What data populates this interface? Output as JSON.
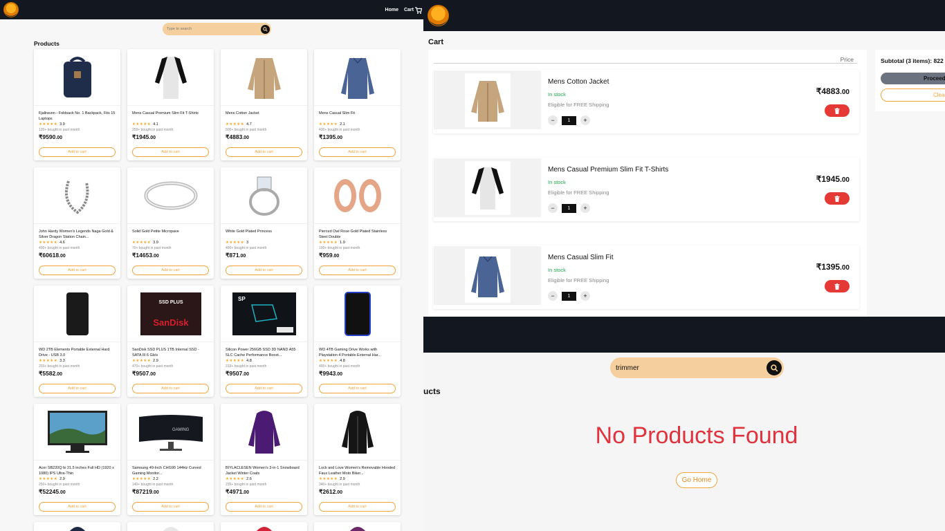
{
  "left": {
    "nav": {
      "home": "Home",
      "cart": "Cart"
    },
    "search": {
      "placeholder": "Type to search"
    },
    "section_title": "Products",
    "add_label": "Add to cart",
    "products": [
      {
        "title": "Fjallraven - Foldsack No. 1 Backpack, Fits 15 Laptops",
        "stars": "★★★★★",
        "rating": "3.9",
        "bought": "120+ bought in past month",
        "price": "₹9590",
        "dec": ".00",
        "img": "backpack"
      },
      {
        "title": "Mens Casual Premium Slim Fit T-Shirts",
        "stars": "★★★★★",
        "rating": "4.1",
        "bought": "259+ bought in past month",
        "price": "₹1945",
        "dec": ".00",
        "img": "raglan"
      },
      {
        "title": "Mens Cotton Jacket",
        "stars": "★★★★★",
        "rating": "4.7",
        "bought": "500+ bought in past month",
        "price": "₹4883",
        "dec": ".00",
        "img": "jacket"
      },
      {
        "title": "Mens Casual Slim Fit",
        "stars": "★★★★★",
        "rating": "2.1",
        "bought": "430+ bought in past month",
        "price": "₹1395",
        "dec": ".00",
        "img": "longsleeve"
      },
      {
        "title": "John Hardy Women's Legends Naga Gold & Silver Dragon Station Chain...",
        "stars": "★★★★★",
        "rating": "4.6",
        "bought": "400+ bought in past month",
        "price": "₹60618",
        "dec": ".00",
        "img": "bracelet"
      },
      {
        "title": "Solid Gold Petite Micropave",
        "stars": "★★★★★",
        "rating": "3.9",
        "bought": "70+ bought in past month",
        "price": "₹14653",
        "dec": ".00",
        "img": "ring"
      },
      {
        "title": "White Gold Plated Princess",
        "stars": "★★★★★",
        "rating": "3",
        "bought": "400+ bought in past month",
        "price": "₹871",
        "dec": ".00",
        "img": "princess"
      },
      {
        "title": "Pierced Owl Rose Gold Plated Stainless Steel Double",
        "stars": "★★★★★",
        "rating": "1.9",
        "bought": "100+ bought in past month",
        "price": "₹959",
        "dec": ".00",
        "img": "plugs"
      },
      {
        "title": "WD 2TB Elements Portable External Hard Drive - USB 3.0",
        "stars": "★★★★★",
        "rating": "3.3",
        "bought": "203+ bought in past month",
        "price": "₹5582",
        "dec": ".00",
        "img": "hdd"
      },
      {
        "title": "SanDisk SSD PLUS 1TB Internal SSD - SATA III 6 Gb/s",
        "stars": "★★★★★",
        "rating": "2.9",
        "bought": "470+ bought in past month",
        "price": "₹9507",
        "dec": ".00",
        "img": "sandisk"
      },
      {
        "title": "Silicon Power 256GB SSD 3D NAND A55 SLC Cache Performance Boost...",
        "stars": "★★★★★",
        "rating": "4.8",
        "bought": "319+ bought in past month",
        "price": "₹9507",
        "dec": ".00",
        "img": "sp"
      },
      {
        "title": "WD 4TB Gaming Drive Works with Playstation 4 Portable External Har...",
        "stars": "★★★★★",
        "rating": "4.8",
        "bought": "400+ bought in past month",
        "price": "₹9943",
        "dec": ".00",
        "img": "wdgaming"
      },
      {
        "title": "Acer SB220Q bi 21.5 inches Full HD (1920 x 1080) IPS Ultra-Thin",
        "stars": "★★★★★",
        "rating": "2.9",
        "bought": "250+ bought in past month",
        "price": "₹52245",
        "dec": ".00",
        "img": "monitor"
      },
      {
        "title": "Samsung 49-Inch CHG90 144Hz Curved Gaming Monitor...",
        "stars": "★★★★★",
        "rating": "2.2",
        "bought": "140+ bought in past month",
        "price": "₹87219",
        "dec": ".00",
        "img": "curved"
      },
      {
        "title": "BIYLACLESEN Women's 3-in-1 Snowboard Jacket Winter Coats",
        "stars": "★★★★★",
        "rating": "2.6",
        "bought": "235+ bought in past month",
        "price": "₹4971",
        "dec": ".00",
        "img": "purple"
      },
      {
        "title": "Lock and Love Women's Removable Hooded Faux Leather Moto Biker...",
        "stars": "★★★★★",
        "rating": "2.9",
        "bought": "340+ bought in past month",
        "price": "₹2612",
        "dec": ".00",
        "img": "leather"
      }
    ]
  },
  "cart": {
    "title": "Cart",
    "price_header": "Price",
    "subtotal": "Subtotal (3 items): 822",
    "proceed": "Proceed",
    "clear": "Clear",
    "items": [
      {
        "name": "Mens Cotton Jacket",
        "stock": "In stock",
        "ship": "Eligible for FREE Shipping",
        "qty": "1",
        "price": "₹4883",
        "dec": ".00",
        "img": "jacket"
      },
      {
        "name": "Mens Casual Premium Slim Fit T-Shirts",
        "stock": "In stock",
        "ship": "Eligible for FREE Shipping",
        "qty": "1",
        "price": "₹1945",
        "dec": ".00",
        "img": "raglan"
      },
      {
        "name": "Mens Casual Slim Fit",
        "stock": "In stock",
        "ship": "Eligible for FREE Shipping",
        "qty": "1",
        "price": "₹1395",
        "dec": ".00",
        "img": "longsleeve"
      }
    ]
  },
  "empty": {
    "search_value": "trimmer",
    "section_title": "ucts",
    "message": "No Products Found",
    "go_home": "Go Home"
  },
  "colors": {
    "nav_bg": "#121720",
    "accent": "#f2a33a",
    "search_bg": "#f5cf9d",
    "danger": "#e53935",
    "stock": "#1aa34a",
    "no_products": "#e0333e"
  }
}
